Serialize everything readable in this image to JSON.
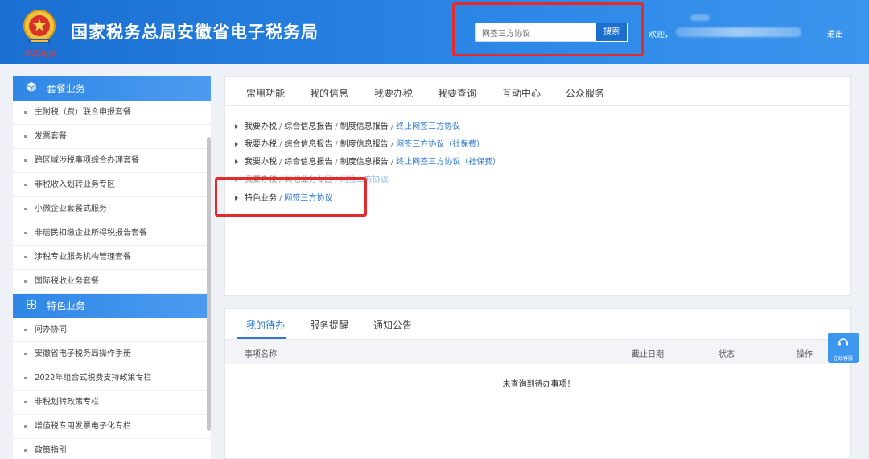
{
  "header": {
    "site_title": "国家税务总局安徽省电子税务局",
    "emblem_signature": "中国税务",
    "search_value": "网签三方协议",
    "search_button": "搜索",
    "welcome": "欢迎，",
    "logout": "退出"
  },
  "sidebar": {
    "groups": [
      {
        "label": "套餐业务",
        "icon": "cube-icon",
        "items": [
          "主附税（费）联合申报套餐",
          "发票套餐",
          "跨区域涉税事项综合办理套餐",
          "非税收入划转业务专区",
          "小微企业套餐式服务",
          "非居民扣缴企业所得税报告套餐",
          "涉税专业服务机构管理套餐",
          "国际税收业务套餐"
        ]
      },
      {
        "label": "特色业务",
        "icon": "four-leaf-icon",
        "items": [
          "问办协同",
          "安徽省电子税务局操作手册",
          "2022年组合式税费支持政策专栏",
          "非税划转政策专栏",
          "增值税专用发票电子化专栏",
          "政策指引"
        ]
      }
    ]
  },
  "top_tabs": [
    "常用功能",
    "我的信息",
    "我要办税",
    "我要查询",
    "互动中心",
    "公众服务"
  ],
  "search_results": [
    {
      "path": [
        "我要办税",
        "综合信息报告",
        "制度信息报告"
      ],
      "link": "终止网签三方协议"
    },
    {
      "path": [
        "我要办税",
        "综合信息报告",
        "制度信息报告"
      ],
      "link": "网签三方协议（社保费）"
    },
    {
      "path": [
        "我要办税",
        "综合信息报告",
        "制度信息报告"
      ],
      "link": "终止网签三方协议（社保费）"
    },
    {
      "path": [
        "我要办税",
        "其他业务专区"
      ],
      "link": "网签三方协议"
    },
    {
      "path": [
        "特色业务"
      ],
      "link": "网签三方协议"
    }
  ],
  "bottom_tabs": [
    "我的待办",
    "服务提醒",
    "通知公告"
  ],
  "table": {
    "columns": [
      "事项名称",
      "截止日期",
      "状态",
      "操作"
    ],
    "empty_message": "未查询到待办事项！"
  },
  "float_support_label": "在线客服",
  "colors": {
    "header_blue": "#2b86e6",
    "accent_blue": "#2a78d4",
    "highlight_red": "#e52a2a"
  }
}
